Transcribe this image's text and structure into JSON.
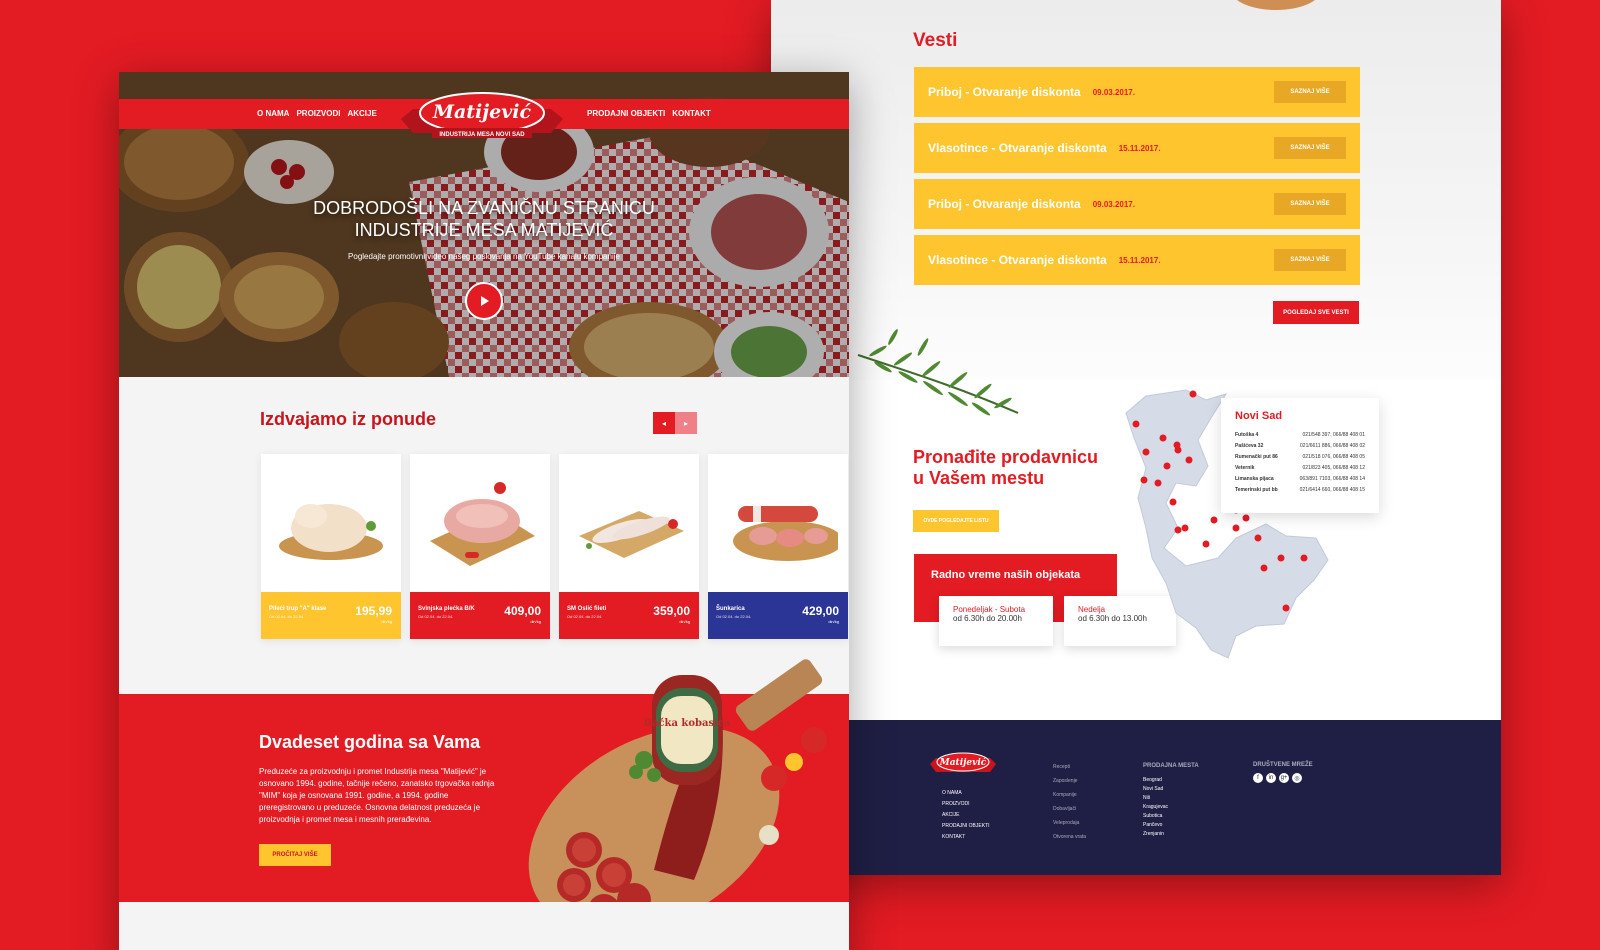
{
  "news": {
    "title": "Vesti",
    "items": [
      {
        "title": "Priboj - Otvaranje diskonta",
        "date": "09.03.2017.",
        "button": "SAZNAJ VIŠE"
      },
      {
        "title": "Vlasotince - Otvaranje diskonta",
        "date": "15.11.2017.",
        "button": "SAZNAJ VIŠE"
      },
      {
        "title": "Priboj - Otvaranje diskonta",
        "date": "09.03.2017.",
        "button": "SAZNAJ VIŠE"
      },
      {
        "title": "Vlasotince - Otvaranje diskonta",
        "date": "15.11.2017.",
        "button": "SAZNAJ VIŠE"
      }
    ],
    "all_button": "POGLEDAJ SVE VESTI"
  },
  "find": {
    "line1": "Pronađite prodavnicu",
    "line2": "u Vašem mestu",
    "button": "OVDE POGLEDAJTE LISTU"
  },
  "hours": {
    "title": "Radno vreme naših objekata",
    "weekday_label": "Ponedeljak - Subota",
    "weekday_time": "od 6.30h do 20.00h",
    "sunday_label": "Nedelja",
    "sunday_time": "od 6.30h do 13.00h"
  },
  "city": {
    "name": "Novi Sad",
    "stores": [
      {
        "name": "Futoška 4",
        "phone": "021/548 397, 066/88 408 01"
      },
      {
        "name": "Pašićeva 32",
        "phone": "021/6611 886, 066/88 408 02"
      },
      {
        "name": "Rumenački put 86",
        "phone": "021/518 076, 066/88 408 05"
      },
      {
        "name": "Veternik",
        "phone": "021/823 405, 066/88 408 12"
      },
      {
        "name": "Limanska pijaca",
        "phone": "063/891 7103, 066/88 408 14"
      },
      {
        "name": "Temerinski put bb",
        "phone": "021/6414 660, 066/88 408 15"
      }
    ]
  },
  "footer": {
    "menu": [
      "O NAMA",
      "PROIZVODI",
      "AKCIJE",
      "PRODAJNI OBJEKTI",
      "KONTAKT"
    ],
    "links": [
      "Recepti",
      "Zaposlenje",
      "Kompanije",
      "Dobavljači",
      "Veleprodaja",
      "Otvorena vrata"
    ],
    "places_title": "PRODAJNA MESTA",
    "places": [
      "Beograd",
      "Novi Sad",
      "Niš",
      "Kragujevac",
      "Subotica",
      "Pančevo",
      "Zrenjanin"
    ],
    "social_title": "DRUŠTVENE MREŽE",
    "social": [
      "f",
      "in",
      "g+",
      "◎"
    ]
  },
  "nav": {
    "left": [
      "O NAMA",
      "PROIZVODI",
      "AKCIJE"
    ],
    "right": [
      "PRODAJNI OBJEKTI",
      "KONTAKT"
    ]
  },
  "logo": {
    "name": "Matijević",
    "tagline": "INDUSTRIJA MESA NOVI SAD"
  },
  "hero": {
    "line1": "DOBRODOŠLI NA ZVANIČNU STRANICU",
    "line2": "INDUSTRIJE MESA MATIJEVIĆ",
    "subtitle": "Pogledajte promotivni video našeg poslovanja na YouTube kanalu kompanije"
  },
  "offer": {
    "title": "Izdvajamo iz ponude",
    "prev": "◂",
    "next": "▸",
    "products": [
      {
        "name": "Pileći trup \"A\" klase",
        "dates": "Od 02.04. do 22.04.",
        "price": "195,99",
        "unit": "din/kg",
        "color": "#ffc52e"
      },
      {
        "name": "Svinjska plećka B/K",
        "dates": "Od 02.04. do 22.04.",
        "price": "409,00",
        "unit": "din/kg",
        "color": "#e31b23"
      },
      {
        "name": "SM Oslić fileti",
        "dates": "Od 02.04. do 22.04.",
        "price": "359,00",
        "unit": "din/kg",
        "color": "#e31b23"
      },
      {
        "name": "Šunkarica",
        "dates": "Od 02.04. do 22.04.",
        "price": "429,00",
        "unit": "din/kg",
        "color": "#2a3596"
      }
    ]
  },
  "story": {
    "title": "Dvadeset godina sa Vama",
    "text": "Preduzeće za proizvodnju i promet Industrija mesa \"Matijević\" je osnovano 1994. godine, tačnije rečeno, zanatsko trgovačka radnja \"MIM\" koja je osnovana 1991. godine, a 1994. godine preregistrovano u preduzeće. Osnovna delatnost preduzeća je proizvodnja i promet mesa i mesnih prerađevina.",
    "button": "PROČITAJ VIŠE",
    "product_label": "Bačka kobasica"
  }
}
